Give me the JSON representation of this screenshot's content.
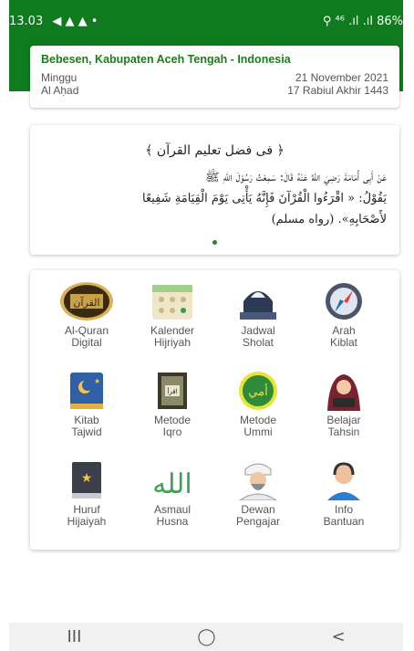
{
  "status_bar": {
    "time": "13.03",
    "left_icons": "◀ ▲ ▲ •",
    "right_text": "⚲ ⁴⁶ .ıl .ıl 86%"
  },
  "location": {
    "title": "Bebesen, Kabupaten Aceh Tengah - Indonesia",
    "day": "Minggu",
    "gregorian_date": "21 November 2021",
    "hijri_day": "Al Aḥad",
    "hijri_date": "17 Rabiul Akhir 1443"
  },
  "hadith": {
    "title": "﴿ فى فضل تعليم القرآن ﴾",
    "line1": "عَنْ أَبِى أُمَامَةَ رَضِيَ اللهُ عَنْهُ قَالَ: سَمِعْتُ رَسُوْلَ اللهِ ﷺ",
    "line2": "يَقُوْلُ: « اقْرَءُوا الْقُرْآنَ فَإِنَّهُ يَأْتِى يَوْمَ الْقِيَامَةِ شَفِيعًا",
    "line3": "لأَصْحَابِهِ». (رواه مسلم)"
  },
  "menu": [
    {
      "label1": "Al-Quran",
      "label2": "Digital",
      "icon": "quran-icon"
    },
    {
      "label1": "Kalender",
      "label2": "Hijriyah",
      "icon": "calendar-icon"
    },
    {
      "label1": "Jadwal",
      "label2": "Sholat",
      "icon": "mosque-icon"
    },
    {
      "label1": "Arah",
      "label2": "Kiblat",
      "icon": "compass-icon"
    },
    {
      "label1": "Kitab",
      "label2": "Tajwid",
      "icon": "book-icon"
    },
    {
      "label1": "Metode",
      "label2": "Iqro",
      "icon": "iqro-book-icon"
    },
    {
      "label1": "Metode",
      "label2": "Ummi",
      "icon": "ummi-logo-icon"
    },
    {
      "label1": "Belajar",
      "label2": "Tahsin",
      "icon": "woman-reading-icon"
    },
    {
      "label1": "Huruf",
      "label2": "Hijaiyah",
      "icon": "hijaiyah-book-icon"
    },
    {
      "label1": "Asmaul",
      "label2": "Husna",
      "icon": "allah-calligraphy-icon"
    },
    {
      "label1": "Dewan",
      "label2": "Pengajar",
      "icon": "teacher-icon"
    },
    {
      "label1": "Info",
      "label2": "Bantuan",
      "icon": "support-agent-icon"
    }
  ],
  "nav": {
    "recents": "III",
    "home": "◯",
    "back": "<"
  },
  "colors": {
    "header_green": "#0f7a1e",
    "title_green": "#1e7a1e"
  }
}
